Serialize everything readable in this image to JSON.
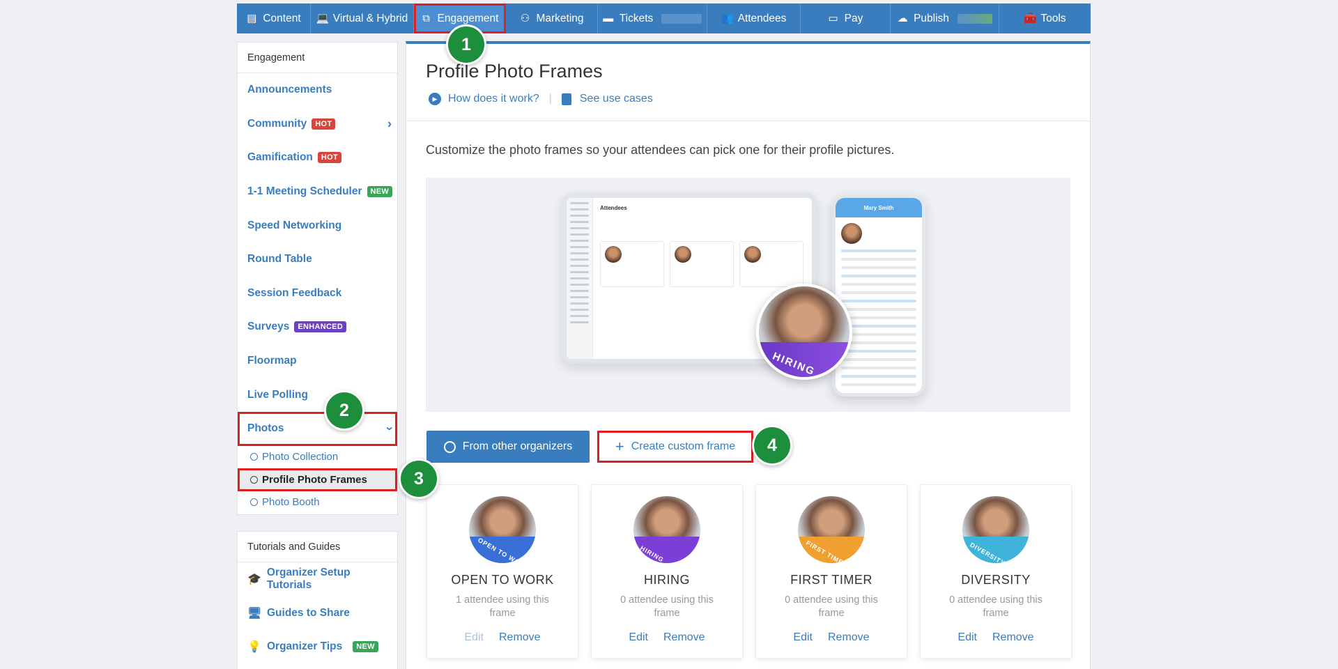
{
  "topnav": {
    "tabs": [
      {
        "label": "Content",
        "icon": "list-icon"
      },
      {
        "label": "Virtual & Hybrid",
        "icon": "laptop-icon"
      },
      {
        "label": "Engagement",
        "icon": "network-icon"
      },
      {
        "label": "Marketing",
        "icon": "circles-icon"
      },
      {
        "label": "Tickets",
        "icon": "ticket-icon"
      },
      {
        "label": "Attendees",
        "icon": "users-icon"
      },
      {
        "label": "Pay",
        "icon": "card-icon"
      },
      {
        "label": "Publish",
        "icon": "cloud-upload-icon"
      },
      {
        "label": "Tools",
        "icon": "toolbox-icon"
      }
    ]
  },
  "sidebar": {
    "heading": "Engagement",
    "items": [
      {
        "label": "Announcements"
      },
      {
        "label": "Community",
        "badge": "HOT"
      },
      {
        "label": "Gamification",
        "badge": "HOT"
      },
      {
        "label": "1-1 Meeting Scheduler",
        "badge": "NEW"
      },
      {
        "label": "Speed Networking"
      },
      {
        "label": "Round Table"
      },
      {
        "label": "Session Feedback"
      },
      {
        "label": "Surveys",
        "badge": "ENHANCED"
      },
      {
        "label": "Floormap"
      },
      {
        "label": "Live Polling"
      },
      {
        "label": "Photos"
      }
    ],
    "photos_sub": [
      {
        "label": "Photo Collection"
      },
      {
        "label": "Profile Photo Frames"
      },
      {
        "label": "Photo Booth"
      }
    ]
  },
  "tutorials": {
    "heading": "Tutorials and Guides",
    "items": [
      {
        "label": "Organizer Setup Tutorials",
        "icon": "graduation-cap-icon"
      },
      {
        "label": "Guides to Share",
        "icon": "share-screen-icon"
      },
      {
        "label": "Organizer Tips",
        "icon": "lightbulb-icon",
        "badge": "NEW"
      }
    ]
  },
  "main": {
    "title": "Profile Photo Frames",
    "how_link": "How does it work?",
    "use_cases_link": "See use cases",
    "description": "Customize the photo frames so your attendees can pick one for their profile pictures.",
    "hero": {
      "laptop_heading": "Attendees",
      "phone_name": "Mary Smith",
      "frame_text": "HIRING"
    },
    "btn_other": "From other organizers",
    "btn_create": "Create custom frame",
    "frames": [
      {
        "name": "OPEN TO WORK",
        "using": "1 attendee using this frame",
        "edit": "Edit",
        "remove": "Remove",
        "color": "#3b6fd8",
        "edit_disabled": true
      },
      {
        "name": "HIRING",
        "using": "0 attendee using this frame",
        "edit": "Edit",
        "remove": "Remove",
        "color": "#7b3fd6",
        "edit_disabled": false
      },
      {
        "name": "FIRST TIMER",
        "using": "0 attendee using this frame",
        "edit": "Edit",
        "remove": "Remove",
        "color": "#f0a030",
        "edit_disabled": false
      },
      {
        "name": "DIVERSITY",
        "using": "0 attendee using this frame",
        "edit": "Edit",
        "remove": "Remove",
        "color": "#3fb3d9",
        "edit_disabled": false
      }
    ]
  },
  "steps": [
    "1",
    "2",
    "3",
    "4"
  ],
  "colors": {
    "nav": "#3a7dbf",
    "accent": "#3a7dbf",
    "highlight": "#e02020",
    "step": "#1d8f3c"
  }
}
